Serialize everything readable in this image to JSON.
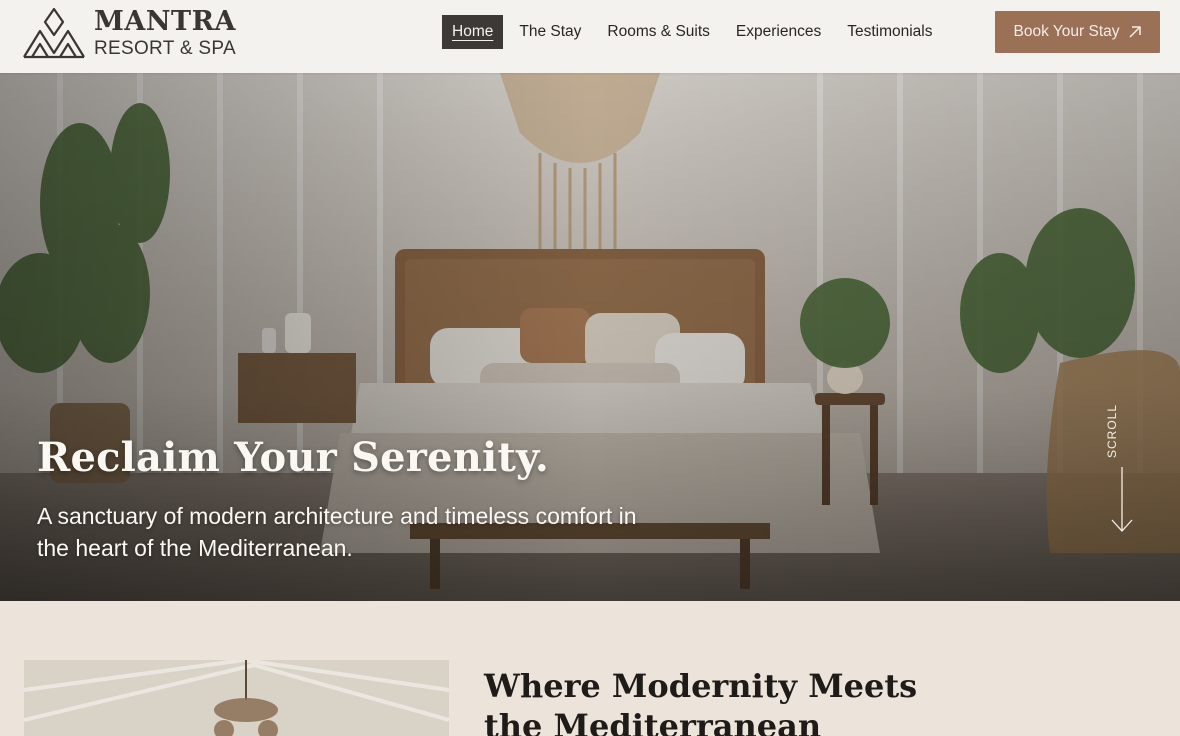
{
  "brand": {
    "name": "MANTRA",
    "subtitle": "RESORT & SPA"
  },
  "nav": {
    "items": [
      {
        "label": "Home",
        "active": true
      },
      {
        "label": "The Stay",
        "active": false
      },
      {
        "label": "Rooms & Suits",
        "active": false
      },
      {
        "label": "Experiences",
        "active": false
      },
      {
        "label": "Testimonials",
        "active": false
      }
    ]
  },
  "cta": {
    "label": "Book Your Stay",
    "icon": "arrow-up-right-icon"
  },
  "hero": {
    "title": "Reclaim Your Serenity.",
    "subtitle": "A sanctuary of modern architecture and timeless comfort in the heart of the Mediterranean.",
    "scroll_label": "SCROLL"
  },
  "about": {
    "title": "Where Modernity Meets the Mediterranean"
  },
  "colors": {
    "accent": "#9a7157",
    "header_bg": "#f4f2ee",
    "section_bg": "#ece3da",
    "nav_active_bg": "#3d3936"
  }
}
